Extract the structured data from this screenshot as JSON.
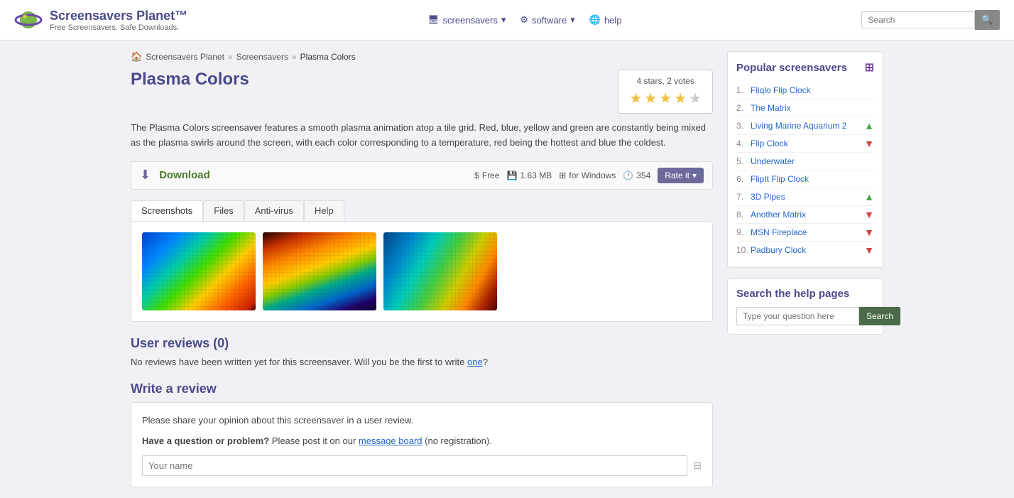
{
  "header": {
    "logo_title": "Screensavers Planet™",
    "logo_subtitle": "Free Screensavers. Safe Downloads.",
    "nav": [
      {
        "label": "screensavers",
        "icon": "🖥",
        "hasDropdown": true
      },
      {
        "label": "software",
        "icon": "⚙",
        "hasDropdown": true
      },
      {
        "label": "help",
        "icon": "🌐",
        "hasDropdown": false
      }
    ],
    "search_placeholder": "Search"
  },
  "breadcrumb": {
    "home_icon": "🏠",
    "items": [
      {
        "label": "Screensavers Planet",
        "href": "#"
      },
      {
        "label": "Screensavers",
        "href": "#"
      },
      {
        "label": "Plasma Colors",
        "href": "#"
      }
    ]
  },
  "page": {
    "title": "Plasma Colors",
    "rating_summary": "4 stars, 2 votes",
    "stars": [
      true,
      true,
      true,
      true,
      false
    ],
    "description": "The Plasma Colors screensaver features a smooth plasma animation atop a tile grid. Red, blue, yellow and green are constantly being mixed as the plasma swirls around the screen, with each color corresponding to a temperature, red being the hottest and blue the coldest.",
    "download": {
      "label": "Download",
      "price": "Free",
      "size": "1.63 MB",
      "platform": "for Windows",
      "downloads": "354",
      "rate_label": "Rate it"
    },
    "tabs": [
      "Screenshots",
      "Files",
      "Anti-virus",
      "Help"
    ],
    "active_tab": "Screenshots",
    "user_reviews_title": "User reviews (0)",
    "reviews_empty_text": "No reviews have been written yet for this screensaver. Will you be the first to write ",
    "reviews_link_text": "one",
    "reviews_link_suffix": "?",
    "write_review_title": "Write a review",
    "review_form": {
      "share_text": "Please share your opinion about this screensaver in a user review.",
      "question_text": "Have a question or problem?",
      "post_text": " Please post it on our ",
      "board_text": "message board",
      "no_reg_text": " (no registration).",
      "name_placeholder": "Your name"
    }
  },
  "sidebar": {
    "popular_title": "Popular screensavers",
    "popular_items": [
      {
        "num": "1.",
        "label": "Fliqlo Flip Clock",
        "trend": "none"
      },
      {
        "num": "2.",
        "label": "The Matrix",
        "trend": "none"
      },
      {
        "num": "3.",
        "label": "Living Marine Aquarium 2",
        "trend": "up"
      },
      {
        "num": "4.",
        "label": "Flip Clock",
        "trend": "down"
      },
      {
        "num": "5.",
        "label": "Underwater",
        "trend": "none"
      },
      {
        "num": "6.",
        "label": "FlipIt Flip Clock",
        "trend": "none"
      },
      {
        "num": "7.",
        "label": "3D Pipes",
        "trend": "up"
      },
      {
        "num": "8.",
        "label": "Another Matrix",
        "trend": "down"
      },
      {
        "num": "9.",
        "label": "MSN Fireplace",
        "trend": "down"
      },
      {
        "num": "10.",
        "label": "Padbury Clock",
        "trend": "down"
      }
    ],
    "help_title": "Search the help pages",
    "help_placeholder": "Type your question here",
    "help_search_label": "Search"
  }
}
